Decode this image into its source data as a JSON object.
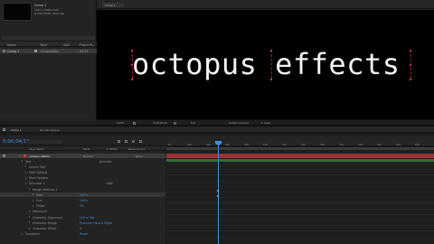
{
  "project": {
    "comp_name": "Comp 1",
    "comp_info_1": "1920 x 1080 (1.00)",
    "comp_info_2": "Δ 0;00;30;00, 29.97 fps",
    "search_placeholder": "",
    "col_name": "Name",
    "col_type": "Type",
    "col_size": "Size",
    "col_fr": "Frame R...",
    "item_name": "Comp 1",
    "item_type": "Composition",
    "item_fr": "29.97"
  },
  "viewer": {
    "tab_label": "Comp 1",
    "text": "octopus effects",
    "zoom": "100%",
    "quality": "Full",
    "camera": "Active Camera",
    "views": "1 View",
    "timecode_small": "0;00;04;10"
  },
  "timeline": {
    "tab_label": "Comp 1",
    "render_queue": "Render Queue",
    "timecode": "0;00;04;10",
    "search_placeholder": "",
    "col_layer_name": "Layer Name",
    "col_mode": "Mode",
    "col_trkmat": "T TrkMat",
    "col_parent": "Parent & Link",
    "layer_1": "octopus effects",
    "layer_1_mode": "Normal",
    "layer_1_parent": "None",
    "props": [
      {
        "label": "Text",
        "value": "Animate:"
      },
      {
        "label": "Source Text",
        "value": ""
      },
      {
        "label": "Path Options",
        "value": ""
      },
      {
        "label": "More Options",
        "value": ""
      },
      {
        "label": "Animator 1",
        "value": "Add:"
      },
      {
        "label": "Range Selector 1",
        "value": ""
      },
      {
        "label": "Start",
        "value": "100%"
      },
      {
        "label": "End",
        "value": "100%"
      },
      {
        "label": "Offset",
        "value": "0%"
      },
      {
        "label": "Advanced",
        "value": ""
      },
      {
        "label": "Character Alignment",
        "value": "Left or Top"
      },
      {
        "label": "Character Range",
        "value": "Preserve Case & Digits"
      },
      {
        "label": "Character Offset",
        "value": "0"
      },
      {
        "label": "Transform",
        "value": "Reset"
      }
    ],
    "ruler_ticks": [
      "0s",
      "02s",
      "04s",
      "06s",
      "08s",
      "10s",
      "12s",
      "14s",
      "16s",
      "18s",
      "20s",
      "22s",
      "24s",
      "26s"
    ]
  },
  "colors": {
    "accent": "#3c8fe0",
    "layer_red": "#9a3434",
    "text": "#f2f2f2"
  }
}
